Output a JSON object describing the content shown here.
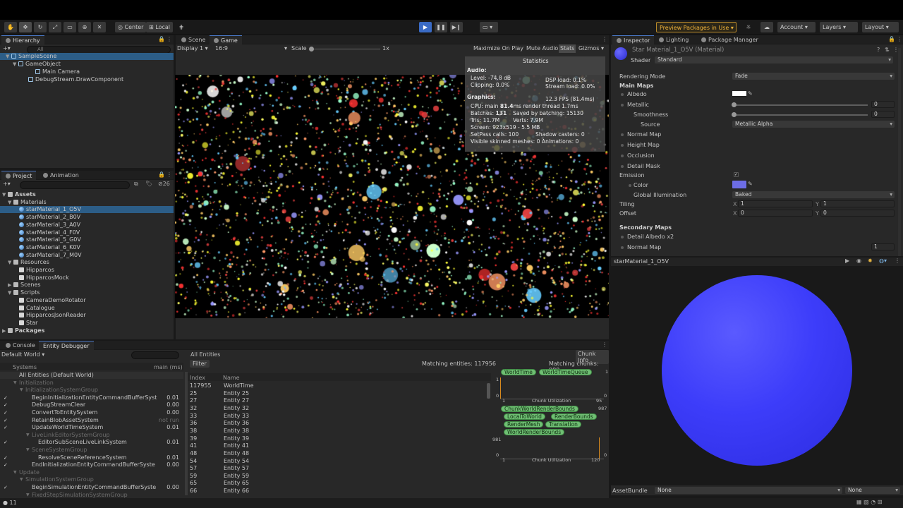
{
  "colors": {
    "accent": "#3a6bc5",
    "preview_border": "#b8892a",
    "selection": "#2c5d87",
    "chip": "#6fbf73",
    "emission": "#6d6de6",
    "sphere": "#3d3dfa"
  },
  "toolbar": {
    "tools": [
      "hand-icon",
      "move-icon",
      "rotate-icon",
      "scale-icon",
      "rect-icon",
      "transform-icon",
      "custom-tool-icon"
    ],
    "pivot": "Center",
    "space": "Local",
    "play_controls": [
      "play-icon",
      "pause-icon",
      "step-icon"
    ],
    "preview_packages": "Preview Packages in Use",
    "account": "Account",
    "layers": "Layers",
    "layout": "Layout"
  },
  "hierarchy": {
    "tab": "Hierarchy",
    "search_placeholder": "All",
    "items": [
      {
        "label": "SampleScene"
      },
      {
        "label": "GameObject"
      },
      {
        "label": "Main Camera"
      },
      {
        "label": "DebugStream.DrawComponent"
      }
    ]
  },
  "scene_tabs": {
    "scene": "Scene",
    "game": "Game",
    "display": "Display 1",
    "aspect": "16:9",
    "scale_label": "Scale",
    "scale_value": "1x",
    "maximize": "Maximize On Play",
    "mute": "Mute Audio",
    "stats": "Stats",
    "gizmos": "Gizmos"
  },
  "statistics": {
    "title": "Statistics",
    "audio_header": "Audio:",
    "level": "Level: -74.8 dB",
    "clipping": "Clipping: 0.0%",
    "dsp": "DSP load: 0.1%",
    "stream": "Stream load: 0.0%",
    "graphics_header": "Graphics:",
    "fps": "12.3 FPS (81.4ms)",
    "cpu_prefix": "CPU: main ",
    "cpu_main": "81.4",
    "cpu_suffix": "ms  render thread 1.7ms",
    "batches_prefix": "Batches: ",
    "batches": "131",
    "saved": "Saved by batching: 15130",
    "tris": "Tris: 11.7M",
    "verts": "Verts: 7.9M",
    "screen": "Screen: 923x519 - 5.5 MB",
    "setpass": "SetPass calls: 100",
    "shadow": "Shadow casters: 0",
    "skinned": "Visible skinned meshes: 0  Animations: 0"
  },
  "project": {
    "tab_project": "Project",
    "tab_animation": "Animation",
    "count": "26",
    "items": [
      {
        "label": "Assets"
      },
      {
        "label": "Materials"
      },
      {
        "label": "starMaterial_1_O5V"
      },
      {
        "label": "starMaterial_2_B0V"
      },
      {
        "label": "starMaterial_3_A0V"
      },
      {
        "label": "starMaterial_4_F0V"
      },
      {
        "label": "starMaterial_5_G0V"
      },
      {
        "label": "starMaterial_6_K0V"
      },
      {
        "label": "starMaterial_7_M0V"
      },
      {
        "label": "Resources"
      },
      {
        "label": "Hipparcos"
      },
      {
        "label": "HipparcosMock"
      },
      {
        "label": "Scenes"
      },
      {
        "label": "Scripts"
      },
      {
        "label": "CameraDemoRotator"
      },
      {
        "label": "Catalogue"
      },
      {
        "label": "HipparcosJsonReader"
      },
      {
        "label": "Star"
      },
      {
        "label": "Packages"
      }
    ]
  },
  "inspector": {
    "tab_inspector": "Inspector",
    "tab_lighting": "Lighting",
    "tab_package": "Package Manager",
    "material_name": "Star Material_1_O5V (Material)",
    "shader_label": "Shader",
    "shader_value": "Standard",
    "rendering_mode_label": "Rendering Mode",
    "rendering_mode_value": "Fade",
    "main_maps": "Main Maps",
    "albedo": "Albedo",
    "metallic": "Metallic",
    "metallic_value": "0",
    "smoothness": "Smoothness",
    "smoothness_value": "0",
    "source": "Source",
    "source_value": "Metallic Alpha",
    "normal_map": "Normal Map",
    "height_map": "Height Map",
    "occlusion": "Occlusion",
    "detail_mask": "Detail Mask",
    "emission": "Emission",
    "color": "Color",
    "global_illumination": "Global Illumination",
    "gi_value": "Baked",
    "tiling": "Tiling",
    "offset": "Offset",
    "x_label": "X",
    "y_label": "Y",
    "tiling_x": "1",
    "tiling_y": "1",
    "offset_x": "0",
    "offset_y": "0",
    "secondary_maps": "Secondary Maps",
    "detail_albedo": "Detail Albedo x2",
    "detail_normal": "Normal Map",
    "detail_normal_value": "1",
    "preview_title": "starMaterial_1_O5V",
    "asset_bundle_label": "AssetBundle",
    "asset_bundle_value": "None",
    "asset_variant_value": "None"
  },
  "console": {
    "tab_console": "Console",
    "tab_entity": "Entity Debugger",
    "world": "Default World",
    "systems_header": "Systems",
    "main_ms": "main (ms)",
    "all_entities_header": "All Entities",
    "chunk_info": "Chunk Info",
    "filter": "Filter",
    "matching_entities": "Matching entities: 117956",
    "matching_chunks": "Matching chunks: 988",
    "index_header": "Index",
    "name_header": "Name",
    "count": "11"
  },
  "systems": [
    {
      "label": "All Entities (Default World)",
      "value": "",
      "level": 0,
      "group": false,
      "check": false
    },
    {
      "label": "Initialization",
      "value": "",
      "level": 1,
      "group": true,
      "check": false
    },
    {
      "label": "InitializationSystemGroup",
      "value": "",
      "level": 2,
      "group": true,
      "check": false
    },
    {
      "label": "BeginInitializationEntityCommandBufferSyst",
      "value": "0.01",
      "level": 3,
      "group": false,
      "check": true
    },
    {
      "label": "DebugStreamClear",
      "value": "0.00",
      "level": 3,
      "group": false,
      "check": true
    },
    {
      "label": "ConvertToEntitySystem",
      "value": "0.00",
      "level": 3,
      "group": false,
      "check": true
    },
    {
      "label": "RetainBlobAssetSystem",
      "value": "not run",
      "level": 3,
      "group": false,
      "check": true
    },
    {
      "label": "UpdateWorldTimeSystem",
      "value": "0.01",
      "level": 3,
      "group": false,
      "check": true
    },
    {
      "label": "LiveLinkEditorSystemGroup",
      "value": "",
      "level": 3,
      "group": true,
      "check": false
    },
    {
      "label": "EditorSubSceneLiveLinkSystem",
      "value": "0.01",
      "level": 4,
      "group": false,
      "check": true
    },
    {
      "label": "SceneSystemGroup",
      "value": "",
      "level": 3,
      "group": true,
      "check": false
    },
    {
      "label": "ResolveSceneReferenceSystem",
      "value": "0.01",
      "level": 4,
      "group": false,
      "check": true
    },
    {
      "label": "EndInitializationEntityCommandBufferSyste",
      "value": "0.00",
      "level": 3,
      "group": false,
      "check": true
    },
    {
      "label": "Update",
      "value": "",
      "level": 1,
      "group": true,
      "check": false
    },
    {
      "label": "SimulationSystemGroup",
      "value": "",
      "level": 2,
      "group": true,
      "check": false
    },
    {
      "label": "BeginSimulationEntityCommandBufferSyste",
      "value": "0.00",
      "level": 3,
      "group": false,
      "check": true
    },
    {
      "label": "FixedStepSimulationSystemGroup",
      "value": "",
      "level": 3,
      "group": true,
      "check": false
    }
  ],
  "entities": [
    {
      "index": "117955",
      "name": "WorldTime"
    },
    {
      "index": "25",
      "name": "Entity 25"
    },
    {
      "index": "27",
      "name": "Entity 27"
    },
    {
      "index": "32",
      "name": "Entity 32"
    },
    {
      "index": "33",
      "name": "Entity 33"
    },
    {
      "index": "36",
      "name": "Entity 36"
    },
    {
      "index": "38",
      "name": "Entity 38"
    },
    {
      "index": "39",
      "name": "Entity 39"
    },
    {
      "index": "41",
      "name": "Entity 41"
    },
    {
      "index": "48",
      "name": "Entity 48"
    },
    {
      "index": "54",
      "name": "Entity 54"
    },
    {
      "index": "57",
      "name": "Entity 57"
    },
    {
      "index": "59",
      "name": "Entity 59"
    },
    {
      "index": "65",
      "name": "Entity 65"
    },
    {
      "index": "66",
      "name": "Entity 66"
    }
  ],
  "chunks": {
    "group1": [
      "WorldTime",
      "WorldTimeQueue"
    ],
    "group1_count": "1",
    "group1_axis_top": "1",
    "group1_axis_bottom": "0",
    "group1_x_start": "1",
    "group1_x_end": "95",
    "group1_right_zero": "0",
    "chunk_utilization": "Chunk Utilization",
    "group2": [
      "ChunkWorldRenderBounds",
      "LocalToWorld",
      "RenderBounds",
      "RenderMesh",
      "Translation",
      "WorldRenderBounds"
    ],
    "group2_count": "987",
    "group2_axis_top": "981",
    "group2_axis_bottom": "0",
    "group2_x_start": "1",
    "group2_x_end": "120",
    "group2_right_zero": "0"
  }
}
